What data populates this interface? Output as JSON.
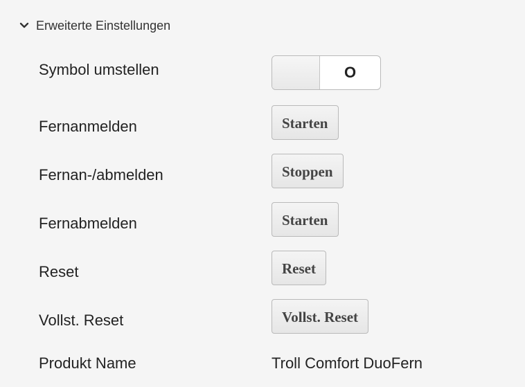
{
  "section": {
    "title": "Erweiterte Einstellungen",
    "expanded": true,
    "icon": "chevron-down-icon"
  },
  "rows": [
    {
      "label": "Symbol umstellen",
      "control": "toggle",
      "state": "O"
    },
    {
      "label": "Fernanmelden",
      "control": "button",
      "button_label": "Starten"
    },
    {
      "label": "Fernan-/abmelden",
      "control": "button",
      "button_label": "Stoppen"
    },
    {
      "label": "Fernabmelden",
      "control": "button",
      "button_label": "Starten"
    },
    {
      "label": "Reset",
      "control": "button",
      "button_label": "Reset"
    },
    {
      "label": "Vollst. Reset",
      "control": "button",
      "button_label": "Vollst. Reset"
    },
    {
      "label": "Produkt Name",
      "control": "text",
      "value": "Troll Comfort DuoFern"
    }
  ],
  "colors": {
    "background": "#f5f5f5",
    "text": "#222222",
    "button_border": "#b9b9b9"
  }
}
